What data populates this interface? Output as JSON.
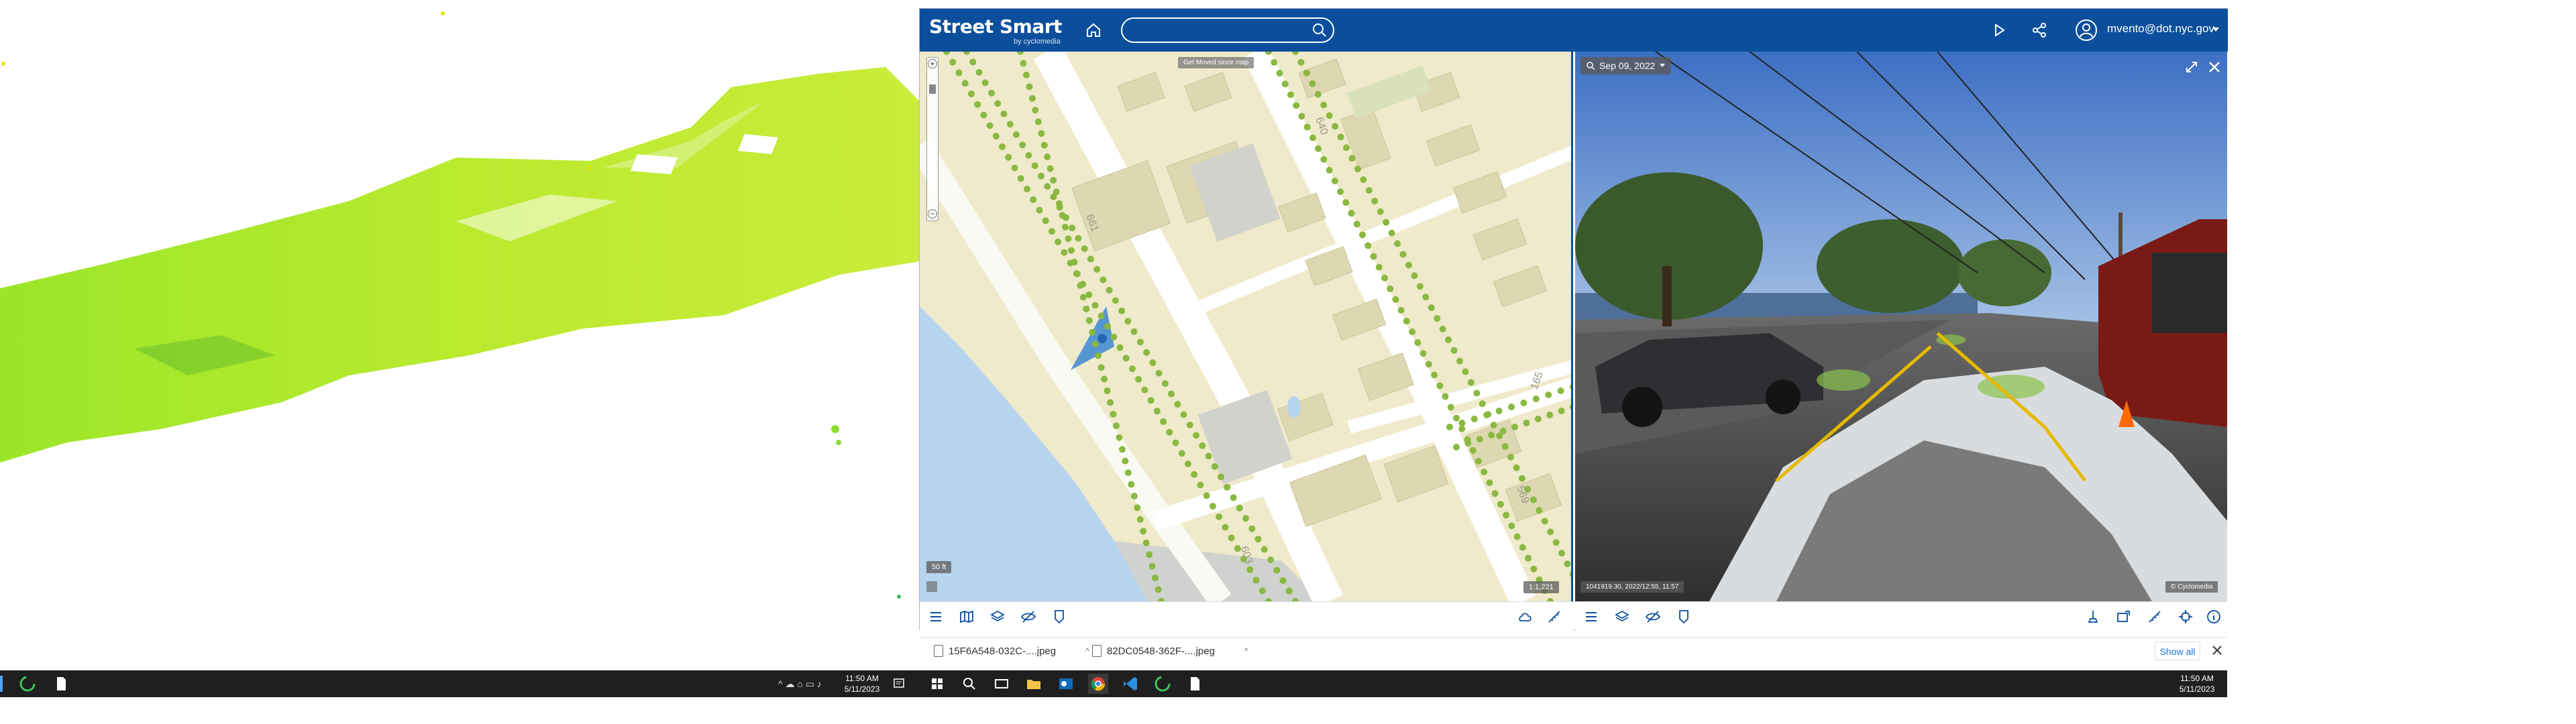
{
  "app": {
    "brand": "Street Smart",
    "brand_sub": "by cyclomedia",
    "user_email": "mvento@dot.nyc.gov"
  },
  "search": {
    "placeholder": "",
    "value": ""
  },
  "map": {
    "label_top": "Get Moved since map",
    "scale_label": "50 ft",
    "coords": "1:1,221",
    "street_labels": [
      "661",
      "165",
      "569",
      "603",
      "640",
      "3"
    ]
  },
  "panorama": {
    "date": "Sep 09, 2022",
    "footer_info": "1041919.30, 2022/12:55, 11:57",
    "copyright": "© Cyclomedia"
  },
  "downloads": {
    "items": [
      {
        "name": "15F6A548-032C-....jpeg"
      },
      {
        "name": "82DC0548-362F-....jpeg"
      }
    ],
    "show_all": "Show all"
  },
  "taskbar_left": {
    "time": "11:50 AM",
    "date": "5/11/2023"
  },
  "taskbar_right": {
    "time": "11:50 AM",
    "date": "5/11/2023"
  },
  "colors": {
    "header": "#0b4f9c",
    "map_base": "#efeacb",
    "tree_dot": "#8ab840",
    "pointcloud_green": "#9adf2a"
  }
}
